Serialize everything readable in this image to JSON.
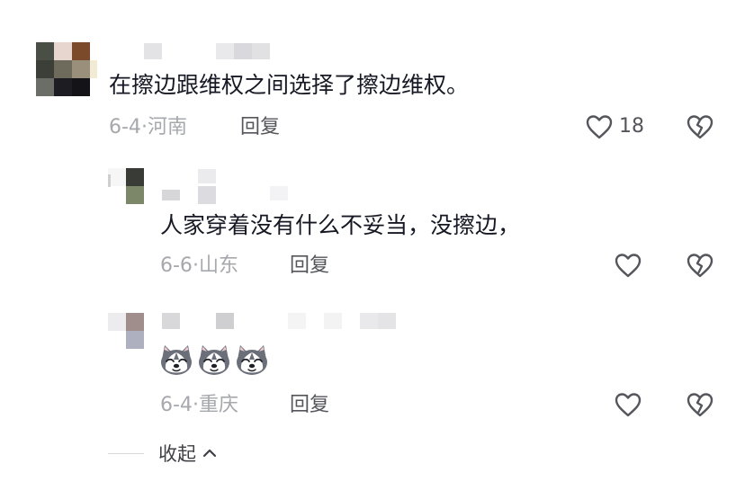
{
  "comments": [
    {
      "text": "在擦边跟维权之间选择了擦边维权。",
      "date": "6-4",
      "location": "河南",
      "reply_label": "回复",
      "likes": "18"
    }
  ],
  "replies": [
    {
      "text": "人家穿着没有什么不妥当，没擦边，",
      "date": "6-6",
      "location": "山东",
      "reply_label": "回复"
    },
    {
      "emoji_count": 3,
      "emoji_name": "husky-emoji",
      "date": "6-4",
      "location": "重庆",
      "reply_label": "回复"
    }
  ],
  "collapse_label": "收起",
  "icons": {
    "like": "heart-outline-icon",
    "dislike": "broken-heart-icon",
    "collapse": "chevron-up-icon"
  },
  "colors": {
    "text": "#161823",
    "meta": "#a7a8ad",
    "icon": "#55565c"
  }
}
